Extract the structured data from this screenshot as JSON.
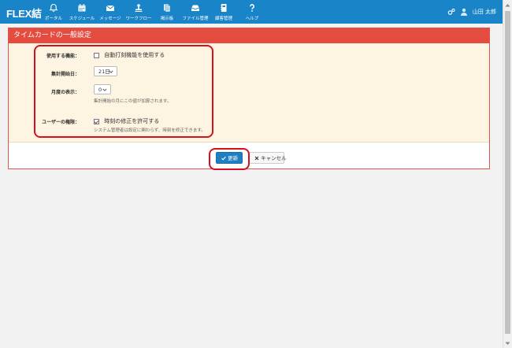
{
  "app": {
    "logo": "FLEX結"
  },
  "nav": [
    {
      "label": "ポータル",
      "icon": "bell-icon"
    },
    {
      "label": "スケジュール",
      "icon": "calendar-icon"
    },
    {
      "label": "メッセージ",
      "icon": "envelope-icon"
    },
    {
      "label": "ワークフロー",
      "icon": "stamp-icon"
    },
    {
      "label": "掲示板",
      "icon": "board-icon"
    },
    {
      "label": "ファイル管理",
      "icon": "inbox-icon"
    },
    {
      "label": "顧客管理",
      "icon": "book-icon"
    },
    {
      "label": "ヘルプ",
      "icon": "question-icon"
    }
  ],
  "user": {
    "name": "山田 太郎"
  },
  "panel": {
    "title": "タイムカードの一般設定",
    "use_feature": {
      "label": "使用する機能：",
      "option": "自動打刻機能を使用する",
      "checked": false
    },
    "start_date": {
      "label": "集計開始日：",
      "value": "21日"
    },
    "month_display": {
      "label": "月度の表示：",
      "value": "0",
      "hint": "集計開始の月にこの値が加算されます。"
    },
    "user_permission": {
      "label": "ユーザーの権限：",
      "option": "時刻の修正を許可する",
      "checked": true,
      "hint": "システム管理者は設定に関わらず、時刻を修正できます。"
    }
  },
  "buttons": {
    "update": "更新",
    "cancel": "キャンセル"
  },
  "colors": {
    "nav_bg": "#1a84c8",
    "panel_header": "#e34c3f",
    "panel_body": "#fdf4e1",
    "highlight": "#d3101e",
    "primary_button": "#1f7fc1"
  }
}
